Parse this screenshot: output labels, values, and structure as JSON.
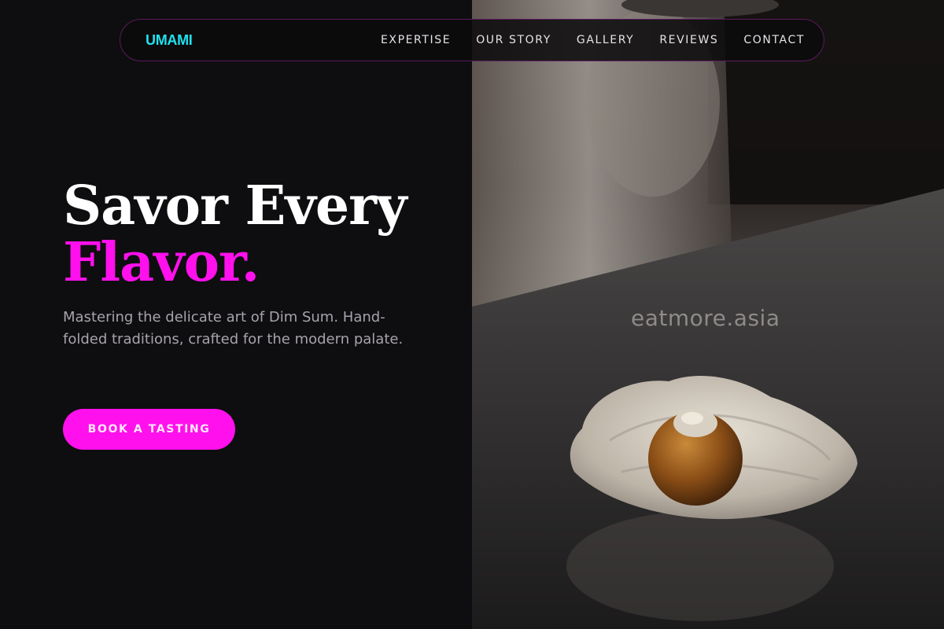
{
  "brand": {
    "name": "UMAMI",
    "color": "#1ee3ef"
  },
  "nav": {
    "links": [
      {
        "label": "EXPERTISE"
      },
      {
        "label": "OUR STORY"
      },
      {
        "label": "GALLERY"
      },
      {
        "label": "REVIEWS"
      },
      {
        "label": "CONTACT"
      }
    ]
  },
  "hero": {
    "headline_line1": "Savor Every",
    "headline_line2": "Flavor.",
    "subtitle": "Mastering the delicate art of Dim Sum. Hand-folded traditions, crafted for the modern palate.",
    "cta_label": "BOOK A TASTING",
    "accent_color": "#ff10ec"
  },
  "photo": {
    "watermark": "eatmore.asia"
  }
}
